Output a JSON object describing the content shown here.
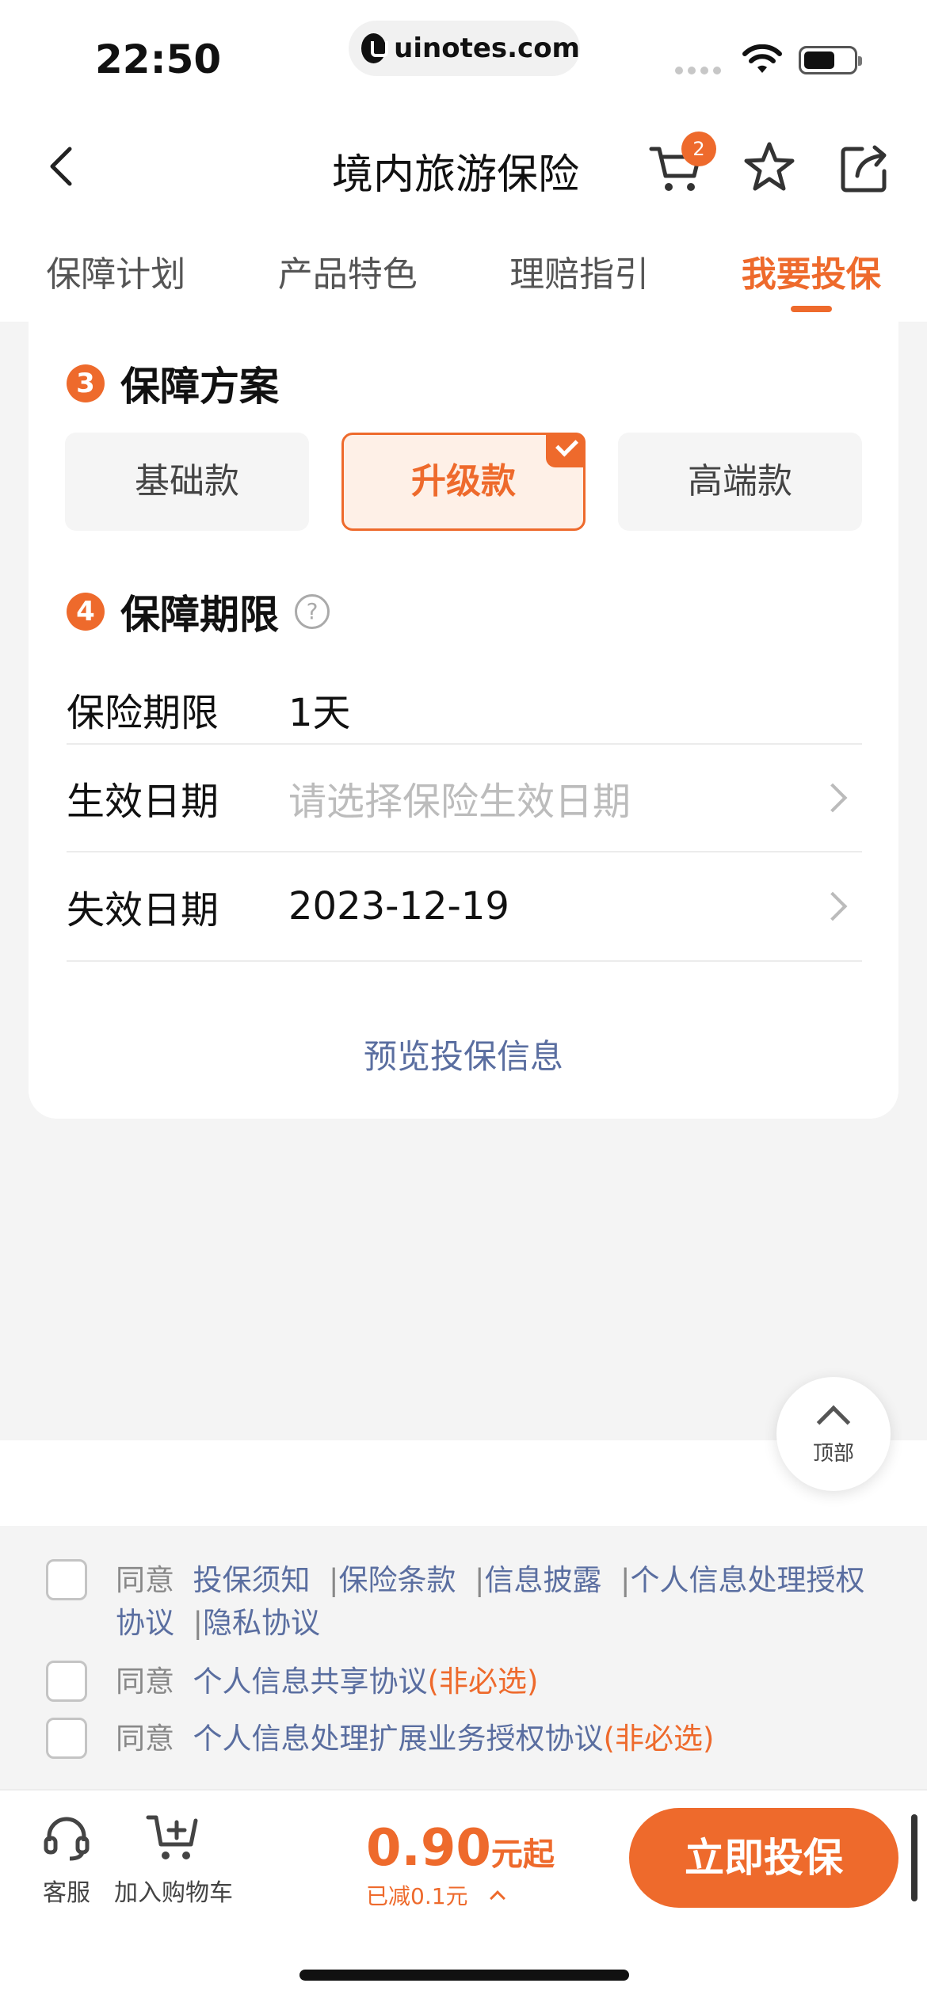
{
  "status_bar": {
    "time": "22:50",
    "url": "uinotes.com"
  },
  "nav": {
    "title": "境内旅游保险",
    "cart_count": "2"
  },
  "tabs": [
    {
      "label": "保障计划"
    },
    {
      "label": "产品特色"
    },
    {
      "label": "理赔指引"
    },
    {
      "label": "我要投保"
    }
  ],
  "plan_section": {
    "number": "3",
    "title": "保障方案",
    "plans": [
      "基础款",
      "升级款",
      "高端款"
    ],
    "selected": "升级款"
  },
  "period_section": {
    "number": "4",
    "title": "保障期限",
    "help_icon": "?",
    "rows": [
      {
        "label": "保险期限",
        "value": "1天"
      },
      {
        "label": "生效日期",
        "placeholder": "请选择保险生效日期"
      },
      {
        "label": "失效日期",
        "value": "2023-12-19"
      }
    ],
    "preview_link": "预览投保信息"
  },
  "to_top": {
    "label": "顶部"
  },
  "agreements": {
    "agree": "同意",
    "row1_links": [
      "投保须知",
      "保险条款",
      "信息披露",
      "个人信息处理授权协议",
      "隐私协议"
    ],
    "row2_link": "个人信息共享协议",
    "row3_link": "个人信息处理扩展业务授权协议",
    "optional": "(非必选)"
  },
  "bottom_bar": {
    "service_label": "客服",
    "cart_label": "加入购物车",
    "price_value": "0.90",
    "price_unit": "元起",
    "discount": "已减0.1元",
    "buy_label": "立即投保"
  },
  "colors": {
    "accent": "#ee6a2c",
    "link": "#5a6ea0"
  }
}
